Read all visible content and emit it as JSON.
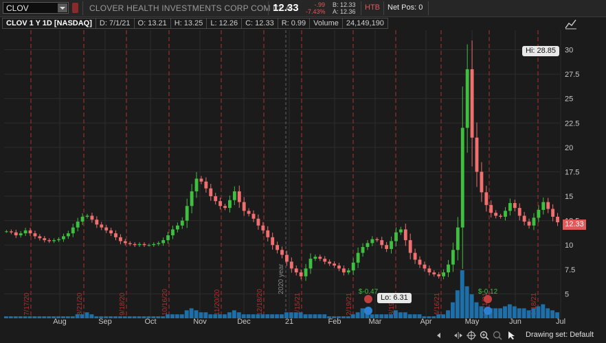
{
  "toolbar": {
    "symbol": "CLOV",
    "company": "CLOVER HEALTH INVESTMENTS CORP COM CL A",
    "last": "12.33",
    "change": "-.99",
    "change_pct": "-7.43%",
    "bid": "B: 12.33",
    "ask": "A: 12.36",
    "htb": "HTB",
    "net_pos": "Net Pos: 0"
  },
  "info_bar": {
    "title": "CLOV 1 Y 1D [NASDAQ]",
    "date": "D: 7/1/21",
    "open": "O: 13.21",
    "high": "H: 13.25",
    "low": "L: 12.26",
    "close": "C: 12.33",
    "range": "R: 0.99",
    "volume_label": "Volume",
    "volume": "24,149,190"
  },
  "chart_data": {
    "type": "candlestick",
    "ylim": [
      2.5,
      32
    ],
    "yticks": [
      "5",
      "7.5",
      "10",
      "12.5",
      "15",
      "17.5",
      "20",
      "22.5",
      "25",
      "27.5",
      "30"
    ],
    "xticks": [
      "Aug",
      "Sep",
      "Oct",
      "Nov",
      "Dec",
      "21",
      "Feb",
      "Mar",
      "Apr",
      "May",
      "Jun",
      "Jul"
    ],
    "year_marker": "2020 year",
    "earnings_labels": [
      "7/17/20",
      "8/21/20",
      "9/18/20",
      "10/16/20",
      "11/20/20",
      "12/18/20",
      "1/15/21",
      "2/19/21",
      "3/19/21",
      "4/16/21",
      "5/21/21",
      "6/18/21"
    ],
    "hi_label": "Hi: 28.85",
    "lo_label": "Lo: 6.31",
    "last_price_tag": "12.33",
    "dividend_labels": [
      "$-0.47",
      "$-0.12"
    ],
    "colors": {
      "up": "#3fbf3f",
      "down": "#f07070",
      "volume": "#1e6ea8",
      "grid": "#2c2c2c",
      "marker": "#b03030"
    },
    "close_series": [
      11.4,
      11.3,
      11.0,
      11.2,
      11.5,
      11.2,
      10.9,
      10.7,
      10.5,
      10.4,
      10.5,
      10.6,
      10.9,
      11.2,
      11.8,
      12.4,
      12.9,
      13.0,
      12.6,
      12.1,
      11.8,
      11.5,
      11.2,
      10.8,
      10.4,
      10.2,
      10.1,
      10.0,
      10.1,
      10.0,
      10.0,
      10.1,
      10.2,
      10.5,
      11.0,
      11.6,
      12.0,
      12.5,
      14.0,
      15.5,
      16.8,
      16.5,
      15.8,
      15.0,
      14.5,
      14.0,
      13.8,
      14.6,
      15.5,
      14.4,
      13.5,
      13.2,
      12.7,
      12.0,
      11.5,
      10.8,
      10.0,
      9.5,
      9.0,
      8.3,
      7.6,
      7.2,
      6.8,
      7.6,
      8.6,
      8.8,
      8.6,
      8.3,
      8.1,
      7.9,
      7.6,
      7.2,
      7.4,
      8.2,
      9.2,
      9.8,
      10.2,
      10.6,
      10.5,
      10.0,
      9.6,
      10.4,
      11.3,
      11.6,
      10.5,
      9.2,
      8.5,
      8.0,
      7.6,
      7.2,
      7.0,
      6.8,
      7.2,
      8.0,
      9.5,
      11.8,
      22.0,
      28.0,
      21.0,
      17.5,
      15.4,
      14.1,
      13.3,
      13.0,
      12.9,
      13.5,
      14.3,
      13.8,
      13.0,
      12.4,
      12.0,
      12.8,
      13.6,
      14.4,
      13.7,
      12.9,
      12.33
    ],
    "volume_series": [
      1,
      1,
      1,
      1,
      1,
      1,
      1,
      1,
      1,
      1,
      1,
      1,
      1,
      1,
      1,
      2,
      2,
      3,
      2,
      1,
      1,
      1,
      1,
      1,
      1,
      1,
      1,
      1,
      1,
      1,
      1,
      1,
      1,
      1,
      2,
      2,
      2,
      2,
      4,
      5,
      4,
      3,
      3,
      2,
      2,
      2,
      2,
      3,
      4,
      3,
      2,
      2,
      2,
      2,
      2,
      2,
      2,
      2,
      2,
      3,
      3,
      3,
      3,
      2,
      2,
      2,
      2,
      2,
      1,
      1,
      1,
      1,
      1,
      2,
      3,
      5,
      3,
      2,
      2,
      2,
      2,
      2,
      4,
      3,
      3,
      2,
      2,
      2,
      1,
      1,
      1,
      2,
      2,
      4,
      8,
      14,
      24,
      16,
      12,
      8,
      6,
      5,
      5,
      5,
      5,
      6,
      7,
      6,
      5,
      5,
      4,
      5,
      6,
      7,
      5,
      4,
      3
    ],
    "drawing_set": "Drawing set: Default"
  }
}
